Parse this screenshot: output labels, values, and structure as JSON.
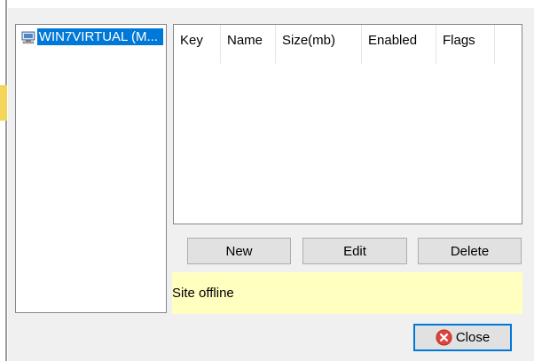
{
  "tree": {
    "items": [
      {
        "label": "WIN7VIRTUAL (M...",
        "icon": "computer-icon",
        "selected": true
      }
    ]
  },
  "table": {
    "columns": [
      "Key",
      "Name",
      "Size(mb)",
      "Enabled",
      "Flags"
    ],
    "rows": []
  },
  "buttons": {
    "new_label": "New",
    "edit_label": "Edit",
    "delete_label": "Delete",
    "close_label": "Close"
  },
  "status": {
    "text": "Site offline"
  },
  "colors": {
    "selection": "#0078d7",
    "status_bg": "#ffffc0",
    "close_icon": "#e0443a"
  }
}
